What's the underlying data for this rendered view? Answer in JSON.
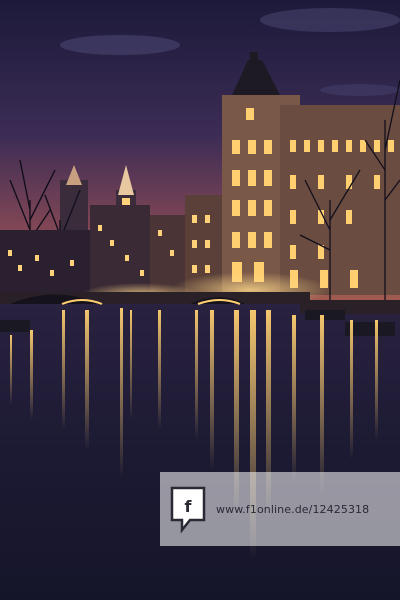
{
  "image": {
    "description_colors": {
      "sky_top": "#1c1a3a",
      "sky_mid": "#3c2c55",
      "sky_horizon": "#8a4a55",
      "water_deep": "#15152a",
      "light_warm": "#ffd27a"
    }
  },
  "watermark": {
    "text": "www.f1online.de/12425318",
    "icon": "f1online-logo-icon"
  }
}
